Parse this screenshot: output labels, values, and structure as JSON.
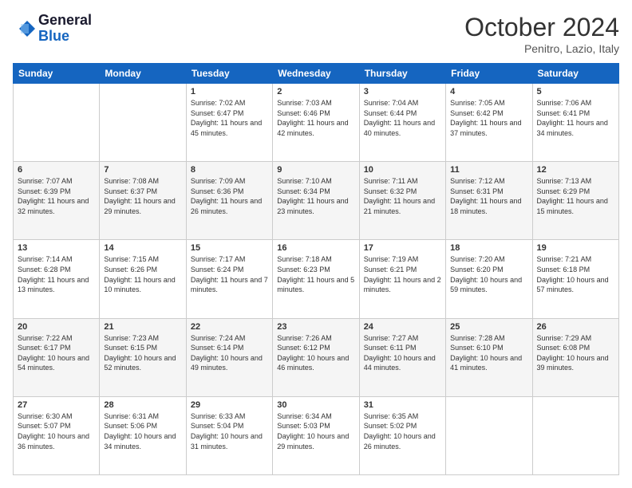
{
  "header": {
    "logo_general": "General",
    "logo_blue": "Blue",
    "month": "October 2024",
    "location": "Penitro, Lazio, Italy"
  },
  "weekdays": [
    "Sunday",
    "Monday",
    "Tuesday",
    "Wednesday",
    "Thursday",
    "Friday",
    "Saturday"
  ],
  "weeks": [
    [
      {
        "day": "",
        "text": ""
      },
      {
        "day": "",
        "text": ""
      },
      {
        "day": "1",
        "text": "Sunrise: 7:02 AM\nSunset: 6:47 PM\nDaylight: 11 hours and 45 minutes."
      },
      {
        "day": "2",
        "text": "Sunrise: 7:03 AM\nSunset: 6:46 PM\nDaylight: 11 hours and 42 minutes."
      },
      {
        "day": "3",
        "text": "Sunrise: 7:04 AM\nSunset: 6:44 PM\nDaylight: 11 hours and 40 minutes."
      },
      {
        "day": "4",
        "text": "Sunrise: 7:05 AM\nSunset: 6:42 PM\nDaylight: 11 hours and 37 minutes."
      },
      {
        "day": "5",
        "text": "Sunrise: 7:06 AM\nSunset: 6:41 PM\nDaylight: 11 hours and 34 minutes."
      }
    ],
    [
      {
        "day": "6",
        "text": "Sunrise: 7:07 AM\nSunset: 6:39 PM\nDaylight: 11 hours and 32 minutes."
      },
      {
        "day": "7",
        "text": "Sunrise: 7:08 AM\nSunset: 6:37 PM\nDaylight: 11 hours and 29 minutes."
      },
      {
        "day": "8",
        "text": "Sunrise: 7:09 AM\nSunset: 6:36 PM\nDaylight: 11 hours and 26 minutes."
      },
      {
        "day": "9",
        "text": "Sunrise: 7:10 AM\nSunset: 6:34 PM\nDaylight: 11 hours and 23 minutes."
      },
      {
        "day": "10",
        "text": "Sunrise: 7:11 AM\nSunset: 6:32 PM\nDaylight: 11 hours and 21 minutes."
      },
      {
        "day": "11",
        "text": "Sunrise: 7:12 AM\nSunset: 6:31 PM\nDaylight: 11 hours and 18 minutes."
      },
      {
        "day": "12",
        "text": "Sunrise: 7:13 AM\nSunset: 6:29 PM\nDaylight: 11 hours and 15 minutes."
      }
    ],
    [
      {
        "day": "13",
        "text": "Sunrise: 7:14 AM\nSunset: 6:28 PM\nDaylight: 11 hours and 13 minutes."
      },
      {
        "day": "14",
        "text": "Sunrise: 7:15 AM\nSunset: 6:26 PM\nDaylight: 11 hours and 10 minutes."
      },
      {
        "day": "15",
        "text": "Sunrise: 7:17 AM\nSunset: 6:24 PM\nDaylight: 11 hours and 7 minutes."
      },
      {
        "day": "16",
        "text": "Sunrise: 7:18 AM\nSunset: 6:23 PM\nDaylight: 11 hours and 5 minutes."
      },
      {
        "day": "17",
        "text": "Sunrise: 7:19 AM\nSunset: 6:21 PM\nDaylight: 11 hours and 2 minutes."
      },
      {
        "day": "18",
        "text": "Sunrise: 7:20 AM\nSunset: 6:20 PM\nDaylight: 10 hours and 59 minutes."
      },
      {
        "day": "19",
        "text": "Sunrise: 7:21 AM\nSunset: 6:18 PM\nDaylight: 10 hours and 57 minutes."
      }
    ],
    [
      {
        "day": "20",
        "text": "Sunrise: 7:22 AM\nSunset: 6:17 PM\nDaylight: 10 hours and 54 minutes."
      },
      {
        "day": "21",
        "text": "Sunrise: 7:23 AM\nSunset: 6:15 PM\nDaylight: 10 hours and 52 minutes."
      },
      {
        "day": "22",
        "text": "Sunrise: 7:24 AM\nSunset: 6:14 PM\nDaylight: 10 hours and 49 minutes."
      },
      {
        "day": "23",
        "text": "Sunrise: 7:26 AM\nSunset: 6:12 PM\nDaylight: 10 hours and 46 minutes."
      },
      {
        "day": "24",
        "text": "Sunrise: 7:27 AM\nSunset: 6:11 PM\nDaylight: 10 hours and 44 minutes."
      },
      {
        "day": "25",
        "text": "Sunrise: 7:28 AM\nSunset: 6:10 PM\nDaylight: 10 hours and 41 minutes."
      },
      {
        "day": "26",
        "text": "Sunrise: 7:29 AM\nSunset: 6:08 PM\nDaylight: 10 hours and 39 minutes."
      }
    ],
    [
      {
        "day": "27",
        "text": "Sunrise: 6:30 AM\nSunset: 5:07 PM\nDaylight: 10 hours and 36 minutes."
      },
      {
        "day": "28",
        "text": "Sunrise: 6:31 AM\nSunset: 5:06 PM\nDaylight: 10 hours and 34 minutes."
      },
      {
        "day": "29",
        "text": "Sunrise: 6:33 AM\nSunset: 5:04 PM\nDaylight: 10 hours and 31 minutes."
      },
      {
        "day": "30",
        "text": "Sunrise: 6:34 AM\nSunset: 5:03 PM\nDaylight: 10 hours and 29 minutes."
      },
      {
        "day": "31",
        "text": "Sunrise: 6:35 AM\nSunset: 5:02 PM\nDaylight: 10 hours and 26 minutes."
      },
      {
        "day": "",
        "text": ""
      },
      {
        "day": "",
        "text": ""
      }
    ]
  ]
}
